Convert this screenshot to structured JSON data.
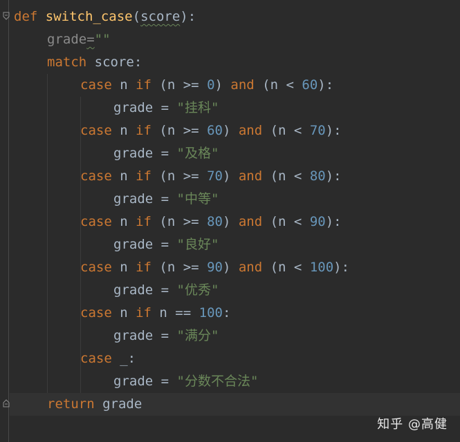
{
  "code": {
    "line1": {
      "kw": "def",
      "fn": "switch_case",
      "open": "(",
      "param": "score",
      "close": "):"
    },
    "line2": {
      "name": "grade",
      "eq": "=",
      "str": "\"\""
    },
    "line3": {
      "kw": "match",
      "rest": " score:"
    },
    "cases": [
      {
        "case": "case",
        "n1": " n ",
        "if": "if",
        "p1": " (n >= ",
        "lo": "0",
        "p2": ") ",
        "and": "and",
        "p3": " (n < ",
        "hi": "60",
        "p4": "):",
        "body": "grade = ",
        "val": "\"挂科\""
      },
      {
        "case": "case",
        "n1": " n ",
        "if": "if",
        "p1": " (n >= ",
        "lo": "60",
        "p2": ") ",
        "and": "and",
        "p3": " (n < ",
        "hi": "70",
        "p4": "):",
        "body": "grade = ",
        "val": "\"及格\""
      },
      {
        "case": "case",
        "n1": " n ",
        "if": "if",
        "p1": " (n >= ",
        "lo": "70",
        "p2": ") ",
        "and": "and",
        "p3": " (n < ",
        "hi": "80",
        "p4": "):",
        "body": "grade = ",
        "val": "\"中等\""
      },
      {
        "case": "case",
        "n1": " n ",
        "if": "if",
        "p1": " (n >= ",
        "lo": "80",
        "p2": ") ",
        "and": "and",
        "p3": " (n < ",
        "hi": "90",
        "p4": "):",
        "body": "grade = ",
        "val": "\"良好\""
      },
      {
        "case": "case",
        "n1": " n ",
        "if": "if",
        "p1": " (n >= ",
        "lo": "90",
        "p2": ") ",
        "and": "and",
        "p3": " (n < ",
        "hi": "100",
        "p4": "):",
        "body": "grade = ",
        "val": "\"优秀\""
      }
    ],
    "case_eq": {
      "case": "case",
      "n1": " n ",
      "if": "if",
      "p1": " n == ",
      "num": "100",
      "p2": ":",
      "body": "grade = ",
      "val": "\"满分\""
    },
    "case_default": {
      "case": "case",
      "rest": " _:",
      "body": "grade = ",
      "val": "\"分数不合法\""
    },
    "return": {
      "kw": "return",
      "rest": " grade"
    }
  },
  "watermark": "知乎 @高健",
  "colors": {
    "background": "#2b2b2b",
    "keyword": "#cc7832",
    "function": "#ffc66d",
    "number": "#6897bb",
    "string": "#6a8759",
    "text": "#a9b7c6"
  }
}
